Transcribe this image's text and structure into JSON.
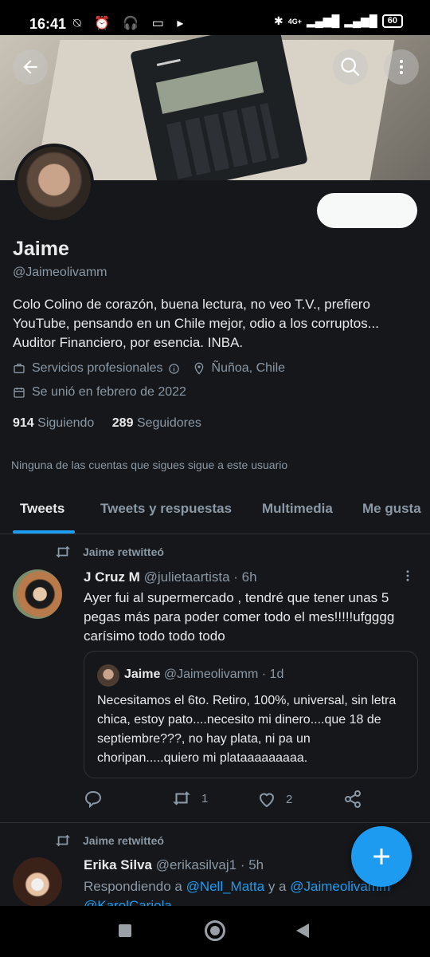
{
  "status_bar": {
    "time": "16:41",
    "left_icons": "⍉ ⏰ 🎧 ▭ ▸",
    "network": "4G+",
    "battery": "60"
  },
  "profile": {
    "name": "Jaime",
    "handle": "@Jaimeolivamm",
    "bio": "Colo Colino de corazón, buena lectura, no veo T.V., prefiero YouTube, pensando en un Chile mejor, odio a los corruptos... Auditor Financiero, por esencia. INBA.",
    "category": "Servicios profesionales",
    "location": "Ñuñoa, Chile",
    "joined": "Se unió en febrero de 2022",
    "following_count": "914",
    "following_label": "Siguiendo",
    "followers_count": "289",
    "followers_label": "Seguidores",
    "notice": "Ninguna de las cuentas que sigues sigue a este usuario"
  },
  "tabs": [
    {
      "label": "Tweets",
      "active": true
    },
    {
      "label": "Tweets y respuestas",
      "active": false
    },
    {
      "label": "Multimedia",
      "active": false
    },
    {
      "label": "Me gusta",
      "active": false
    }
  ],
  "tweets": [
    {
      "retweet_label": "Jaime retwitteó",
      "author": "J Cruz M",
      "handle": "@julietaartista",
      "time": "· 6h",
      "text": "Ayer fui al supermercado , tendré que tener unas 5 pegas más para poder comer todo el mes!!!!!ufgggg carísimo todo todo todo",
      "quote": {
        "author": "Jaime",
        "handle": "@Jaimeolivamm",
        "time": "· 1d",
        "text": "Necesitamos el 6to. Retiro, 100%, universal, sin letra chica, estoy pato....necesito mi dinero....que 18 de septiembre???, no hay plata, ni pa un choripan.....quiero mi plataaaaaaaaa."
      },
      "replies": "",
      "retweets": "1",
      "likes": "2"
    },
    {
      "retweet_label": "Jaime retwitteó",
      "author": "Erika Silva",
      "handle": "@erikasilvaj1",
      "time": "· 5h",
      "reply_prefix": "Respondiendo a",
      "reply_mention_1": "@Nell_Matta",
      "reply_and": "y a",
      "reply_mention_2": "@Jaimeolivamm",
      "reply_mention_3": "@KarolCariola"
    }
  ],
  "colors": {
    "accent": "#1d9bf0",
    "background": "#15171a",
    "muted": "#8b98a5"
  }
}
